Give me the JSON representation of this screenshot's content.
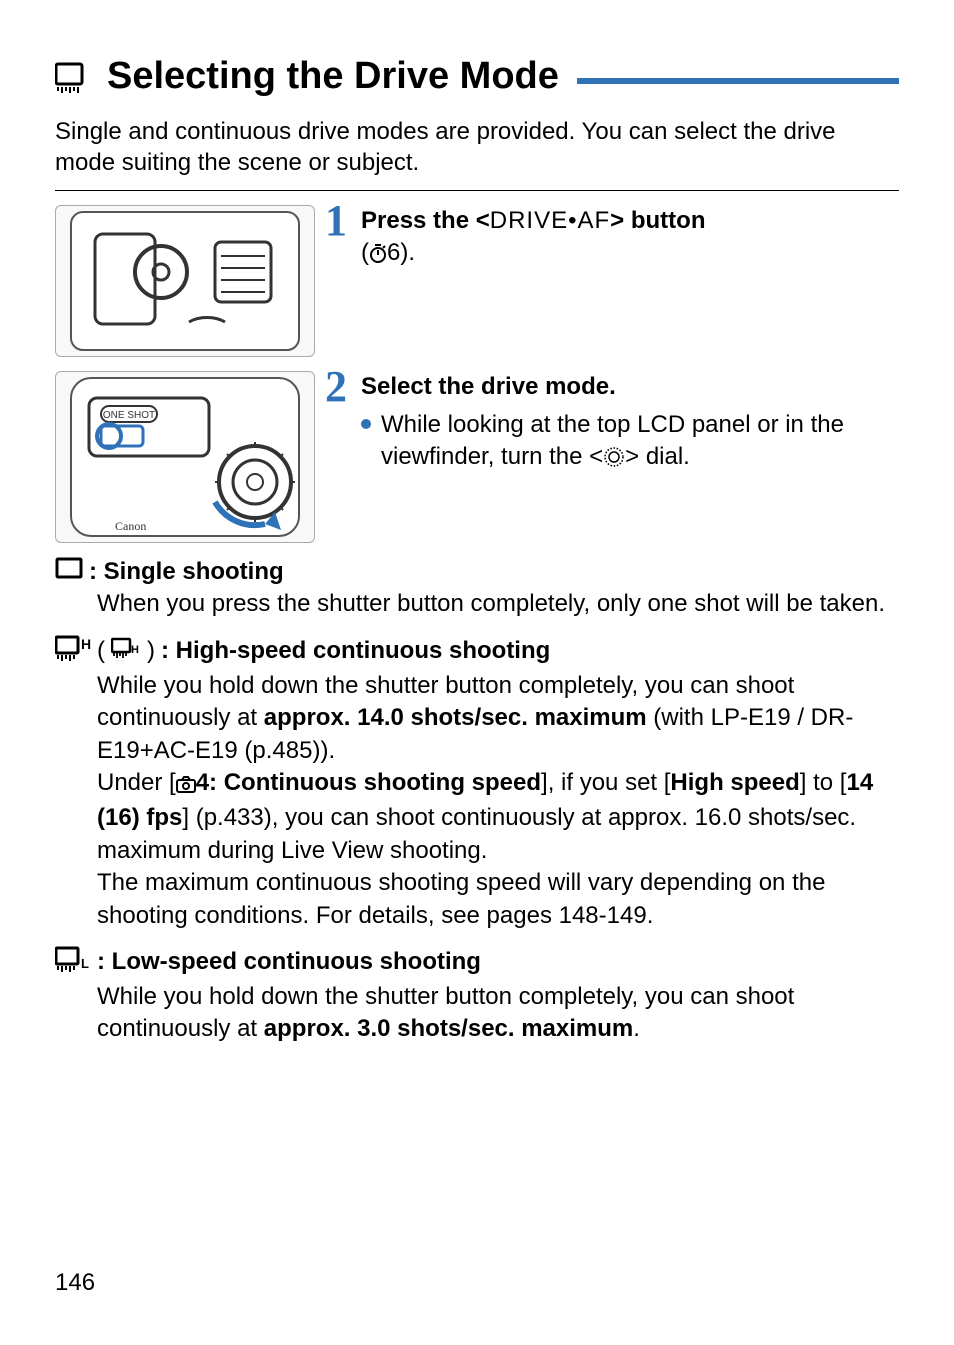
{
  "heading": "Selecting the Drive Mode",
  "intro": "Single and continuous drive modes are provided. You can select the drive mode suiting the scene or subject.",
  "steps": {
    "s1": {
      "num": "1",
      "title_pre": "Press the <",
      "title_sym": "DRIVE•AF",
      "title_post": "> button",
      "sub_open": "(",
      "sub_timer": "6",
      "sub_close": ")."
    },
    "s2": {
      "num": "2",
      "title": "Select the drive mode.",
      "bullet_pre": "While looking at the top LCD panel or in the viewfinder, turn the <",
      "bullet_post": "> dial."
    }
  },
  "defs": {
    "single": {
      "label": ": Single shooting",
      "body": "When you press the shutter button completely, only one shot will be taken."
    },
    "high": {
      "label_open": "(",
      "label_close": ")",
      "label_rest": ": High-speed continuous shooting",
      "body1_pre": "While you hold down the shutter button completely, you can shoot continuously at ",
      "body1_bold": "approx. 14.0 shots/sec. maximum",
      "body1_post": " (with LP-E19 / DR-E19+AC-E19 (p.485)).",
      "body2_pre": "Under [",
      "body2_bold1": "4: Continuous shooting speed",
      "body2_mid1": "], if you set [",
      "body2_bold2": "High speed",
      "body2_mid2": "] to [",
      "body2_bold3": "14 (16) fps",
      "body2_post": "] (p.433), you can shoot continuously at approx. 16.0 shots/sec. maximum during Live View shooting.",
      "body3": "The maximum continuous shooting speed will vary depending on the shooting conditions. For details, see pages 148-149."
    },
    "low": {
      "label_rest": ": Low-speed continuous shooting",
      "body_pre": "While you hold down the shutter button completely, you can shoot continuously at ",
      "body_bold": "approx. 3.0 shots/sec. maximum",
      "body_post": "."
    }
  },
  "page_number": "146"
}
